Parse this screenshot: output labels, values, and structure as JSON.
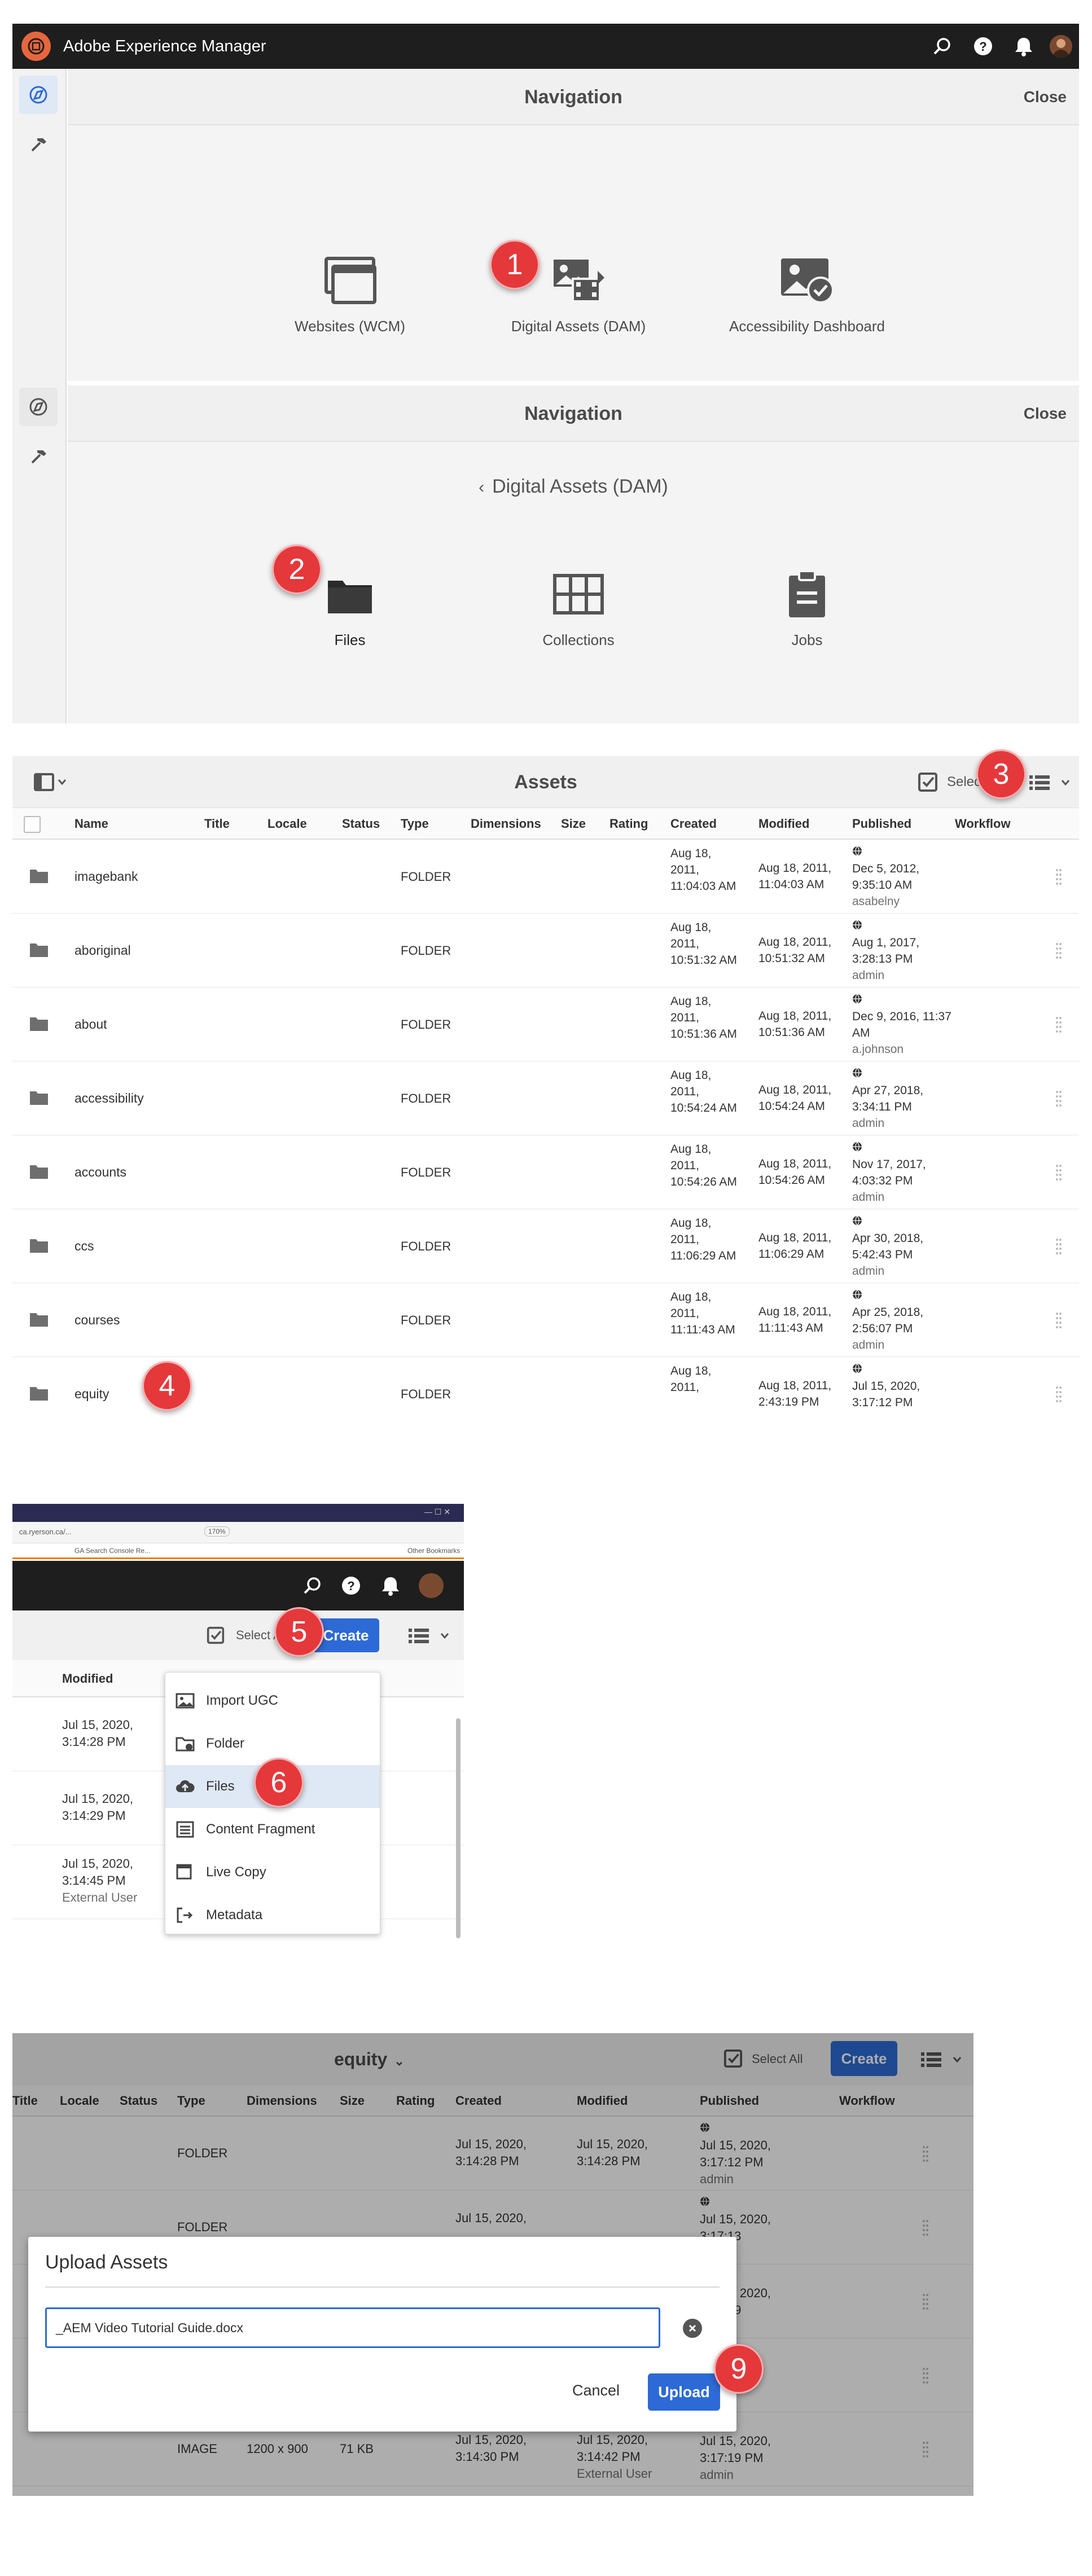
{
  "shell": {
    "title": "Adobe Experience Manager"
  },
  "nav1": {
    "title": "Navigation",
    "close": "Close",
    "tiles": [
      {
        "label": "Websites (WCM)",
        "icon": "websites-icon"
      },
      {
        "label": "Digital Assets (DAM)",
        "icon": "digital-assets-icon"
      },
      {
        "label": "Accessibility Dashboard",
        "icon": "accessibility-dashboard-icon"
      }
    ]
  },
  "nav2": {
    "title": "Navigation",
    "close": "Close",
    "back_label": "Digital Assets (DAM)",
    "tiles": [
      {
        "label": "Files",
        "icon": "folder-icon"
      },
      {
        "label": "Collections",
        "icon": "collections-icon"
      },
      {
        "label": "Jobs",
        "icon": "jobs-icon"
      }
    ]
  },
  "assets": {
    "title": "Assets",
    "select_label": "Select",
    "columns": [
      "Name",
      "Title",
      "Locale",
      "Status",
      "Type",
      "Dimensions",
      "Size",
      "Rating",
      "Created",
      "Modified",
      "Published",
      "Workflow"
    ],
    "rows": [
      {
        "name": "imagebank",
        "type": "FOLDER",
        "created": "Aug 18, 2011, 11:04:03 AM",
        "modified": "Aug 18, 2011, 11:04:03 AM",
        "published": "Dec 5, 2012, 9:35:10 AM",
        "by": "asabelny"
      },
      {
        "name": "aboriginal",
        "type": "FOLDER",
        "created": "Aug 18, 2011, 10:51:32 AM",
        "modified": "Aug 18, 2011, 10:51:32 AM",
        "published": "Aug 1, 2017, 3:28:13 PM",
        "by": "admin"
      },
      {
        "name": "about",
        "type": "FOLDER",
        "created": "Aug 18, 2011, 10:51:36 AM",
        "modified": "Aug 18, 2011, 10:51:36 AM",
        "published": "Dec 9, 2016, 11:37 AM",
        "by": "a.johnson"
      },
      {
        "name": "accessibility",
        "type": "FOLDER",
        "created": "Aug 18, 2011, 10:54:24 AM",
        "modified": "Aug 18, 2011, 10:54:24 AM",
        "published": "Apr 27, 2018, 3:34:11 PM",
        "by": "admin"
      },
      {
        "name": "accounts",
        "type": "FOLDER",
        "created": "Aug 18, 2011, 10:54:26 AM",
        "modified": "Aug 18, 2011, 10:54:26 AM",
        "published": "Nov 17, 2017, 4:03:32 PM",
        "by": "admin"
      },
      {
        "name": "ccs",
        "type": "FOLDER",
        "created": "Aug 18, 2011, 11:06:29 AM",
        "modified": "Aug 18, 2011, 11:06:29 AM",
        "published": "Apr 30, 2018, 5:42:43 PM",
        "by": "admin"
      },
      {
        "name": "courses",
        "type": "FOLDER",
        "created": "Aug 18, 2011, 11:11:43 AM",
        "modified": "Aug 18, 2011, 11:11:43 AM",
        "published": "Apr 25, 2018, 2:56:07 PM",
        "by": "admin"
      },
      {
        "name": "equity",
        "type": "FOLDER",
        "created": "Aug 18, 2011,",
        "modified": "Aug 18, 2011, 2:43:19 PM",
        "published": "Jul 15, 2020, 3:17:12 PM",
        "by": ""
      }
    ]
  },
  "browser": {
    "zoom": "170%",
    "url": "ca.ryerson.ca/...",
    "bookmark": "GA Search Console Re...",
    "other": "Other Bookmarks"
  },
  "create": {
    "select_all": "Select All",
    "create_label": "Create",
    "modified_header": "Modified",
    "rows": [
      {
        "line1": "Jul 15, 2020,",
        "line2": "3:14:28 PM",
        "line3": ""
      },
      {
        "line1": "Jul 15, 2020,",
        "line2": "3:14:29 PM",
        "line3": ""
      },
      {
        "line1": "Jul 15, 2020,",
        "line2": "3:14:45 PM",
        "line3": "External User"
      }
    ],
    "menu": [
      {
        "label": "Import UGC",
        "icon": "import-ugc-icon"
      },
      {
        "label": "Folder",
        "icon": "folder-add-icon"
      },
      {
        "label": "Files",
        "icon": "upload-files-icon"
      },
      {
        "label": "Content Fragment",
        "icon": "content-fragment-icon"
      },
      {
        "label": "Live Copy",
        "icon": "live-copy-icon"
      },
      {
        "label": "Metadata",
        "icon": "metadata-icon"
      }
    ]
  },
  "upload": {
    "folder_title": "equity",
    "select_all": "Select All",
    "create_label": "Create",
    "columns": [
      "Title",
      "Locale",
      "Status",
      "Type",
      "Dimensions",
      "Size",
      "Rating",
      "Created",
      "Modified",
      "Published",
      "Workflow"
    ],
    "rows": [
      {
        "type": "FOLDER",
        "dims": "",
        "size": "",
        "created": "Jul 15, 2020, 3:14:28 PM",
        "modified": "Jul 15, 2020, 3:14:28 PM",
        "published": "Jul 15, 2020, 3:17:12 PM",
        "by": "admin"
      },
      {
        "type": "FOLDER",
        "dims": "",
        "size": "",
        "created": "Jul 15, 2020,",
        "modified": "",
        "published": "Jul 15, 2020, 3:17:13",
        "by": "admin"
      },
      {
        "type": "",
        "dims": "",
        "size": "",
        "created": "",
        "modified": "",
        "published": "Jul 15, 2020, 3:17:19",
        "by": "admin"
      },
      {
        "type": "",
        "dims": "",
        "size": "",
        "created": "",
        "modified": "",
        "published": "3:17:19",
        "by": "admin"
      },
      {
        "type": "IMAGE",
        "dims": "1200 x 900",
        "size": "71 KB",
        "created": "Jul 15, 2020, 3:14:30 PM",
        "modified": "Jul 15, 2020, 3:14:42 PM",
        "by_mod": "External User",
        "published": "Jul 15, 2020, 3:17:19 PM",
        "by": "admin"
      }
    ],
    "dialog": {
      "title": "Upload Assets",
      "file_name": "_AEM Video Tutorial Guide.docx",
      "cancel": "Cancel",
      "upload": "Upload"
    }
  },
  "markers": [
    "1",
    "2",
    "3",
    "4",
    "5",
    "6",
    "9"
  ]
}
